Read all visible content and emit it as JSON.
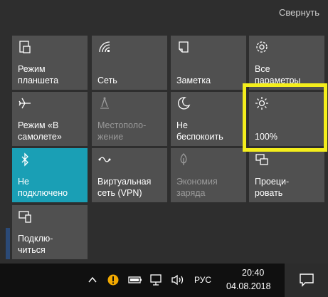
{
  "collapse_label": "Свернуть",
  "accent_color": "#1a9fb5",
  "highlight_color": "#f4ee1c",
  "tiles": [
    {
      "label": "Режим\nпланшета",
      "icon": "tablet-mode-icon",
      "state": "off"
    },
    {
      "label": "Сеть",
      "icon": "network-icon",
      "state": "off"
    },
    {
      "label": "Заметка",
      "icon": "note-icon",
      "state": "off"
    },
    {
      "label": "Все\nпараметры",
      "icon": "gear-icon",
      "state": "off"
    },
    {
      "label": "Режим «В\nсамолете»",
      "icon": "airplane-icon",
      "state": "off"
    },
    {
      "label": "Местополо-\nжение",
      "icon": "location-icon",
      "state": "disabled"
    },
    {
      "label": "Не\nбеспокоить",
      "icon": "moon-icon",
      "state": "off"
    },
    {
      "label": "100%",
      "icon": "brightness-icon",
      "state": "off"
    },
    {
      "label": "Не\nподключено",
      "icon": "bluetooth-icon",
      "state": "on"
    },
    {
      "label": "Виртуальная\nсеть (VPN)",
      "icon": "vpn-icon",
      "state": "off"
    },
    {
      "label": "Экономия\nзаряда",
      "icon": "battery-saver-icon",
      "state": "disabled"
    },
    {
      "label": "Проеци-\nровать",
      "icon": "project-icon",
      "state": "off"
    },
    {
      "label": "Подклю-\nчиться",
      "icon": "connect-icon",
      "state": "off"
    }
  ],
  "taskbar": {
    "language": "РУС",
    "time": "20:40",
    "date": "04.08.2018"
  }
}
